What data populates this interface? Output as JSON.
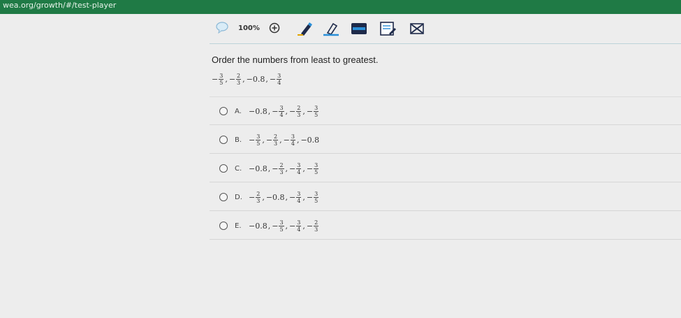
{
  "browser": {
    "url": "wea.org/growth/#/test-player"
  },
  "toolbar": {
    "zoom_label": "100%"
  },
  "question": {
    "prompt": "Order the numbers from least to greatest.",
    "expression": [
      {
        "type": "frac",
        "sign": "−",
        "num": "3",
        "den": "5"
      },
      {
        "type": "frac",
        "sign": "−",
        "num": "2",
        "den": "3"
      },
      {
        "type": "dec",
        "text": "−0.8"
      },
      {
        "type": "frac",
        "sign": "−",
        "num": "3",
        "den": "4"
      }
    ]
  },
  "choices": [
    {
      "letter": "A.",
      "terms": [
        {
          "type": "dec",
          "text": "−0.8"
        },
        {
          "type": "frac",
          "sign": "−",
          "num": "3",
          "den": "4"
        },
        {
          "type": "frac",
          "sign": "−",
          "num": "2",
          "den": "3"
        },
        {
          "type": "frac",
          "sign": "−",
          "num": "3",
          "den": "5"
        }
      ]
    },
    {
      "letter": "B.",
      "terms": [
        {
          "type": "frac",
          "sign": "−",
          "num": "3",
          "den": "5"
        },
        {
          "type": "frac",
          "sign": "−",
          "num": "2",
          "den": "3"
        },
        {
          "type": "frac",
          "sign": "−",
          "num": "3",
          "den": "4"
        },
        {
          "type": "dec",
          "text": "−0.8"
        }
      ]
    },
    {
      "letter": "C.",
      "terms": [
        {
          "type": "dec",
          "text": "−0.8"
        },
        {
          "type": "frac",
          "sign": "−",
          "num": "2",
          "den": "3"
        },
        {
          "type": "frac",
          "sign": "−",
          "num": "3",
          "den": "4"
        },
        {
          "type": "frac",
          "sign": "−",
          "num": "3",
          "den": "5"
        }
      ]
    },
    {
      "letter": "D.",
      "terms": [
        {
          "type": "frac",
          "sign": "−",
          "num": "2",
          "den": "3"
        },
        {
          "type": "dec",
          "text": "−0.8"
        },
        {
          "type": "frac",
          "sign": "−",
          "num": "3",
          "den": "4"
        },
        {
          "type": "frac",
          "sign": "−",
          "num": "3",
          "den": "5"
        }
      ]
    },
    {
      "letter": "E.",
      "terms": [
        {
          "type": "dec",
          "text": "−0.8"
        },
        {
          "type": "frac",
          "sign": "−",
          "num": "3",
          "den": "5"
        },
        {
          "type": "frac",
          "sign": "−",
          "num": "3",
          "den": "4"
        },
        {
          "type": "frac",
          "sign": "−",
          "num": "2",
          "den": "3"
        }
      ]
    }
  ],
  "colors": {
    "browser_bar": "#1f7a45",
    "accent": "#2a8fd8",
    "tool_dark": "#1e2a4a"
  },
  "icons": [
    "speech-bubble-icon",
    "zoom-in-icon",
    "pencil-icon",
    "highlighter-icon",
    "line-reader-icon",
    "notepad-icon",
    "answer-eliminator-icon"
  ]
}
